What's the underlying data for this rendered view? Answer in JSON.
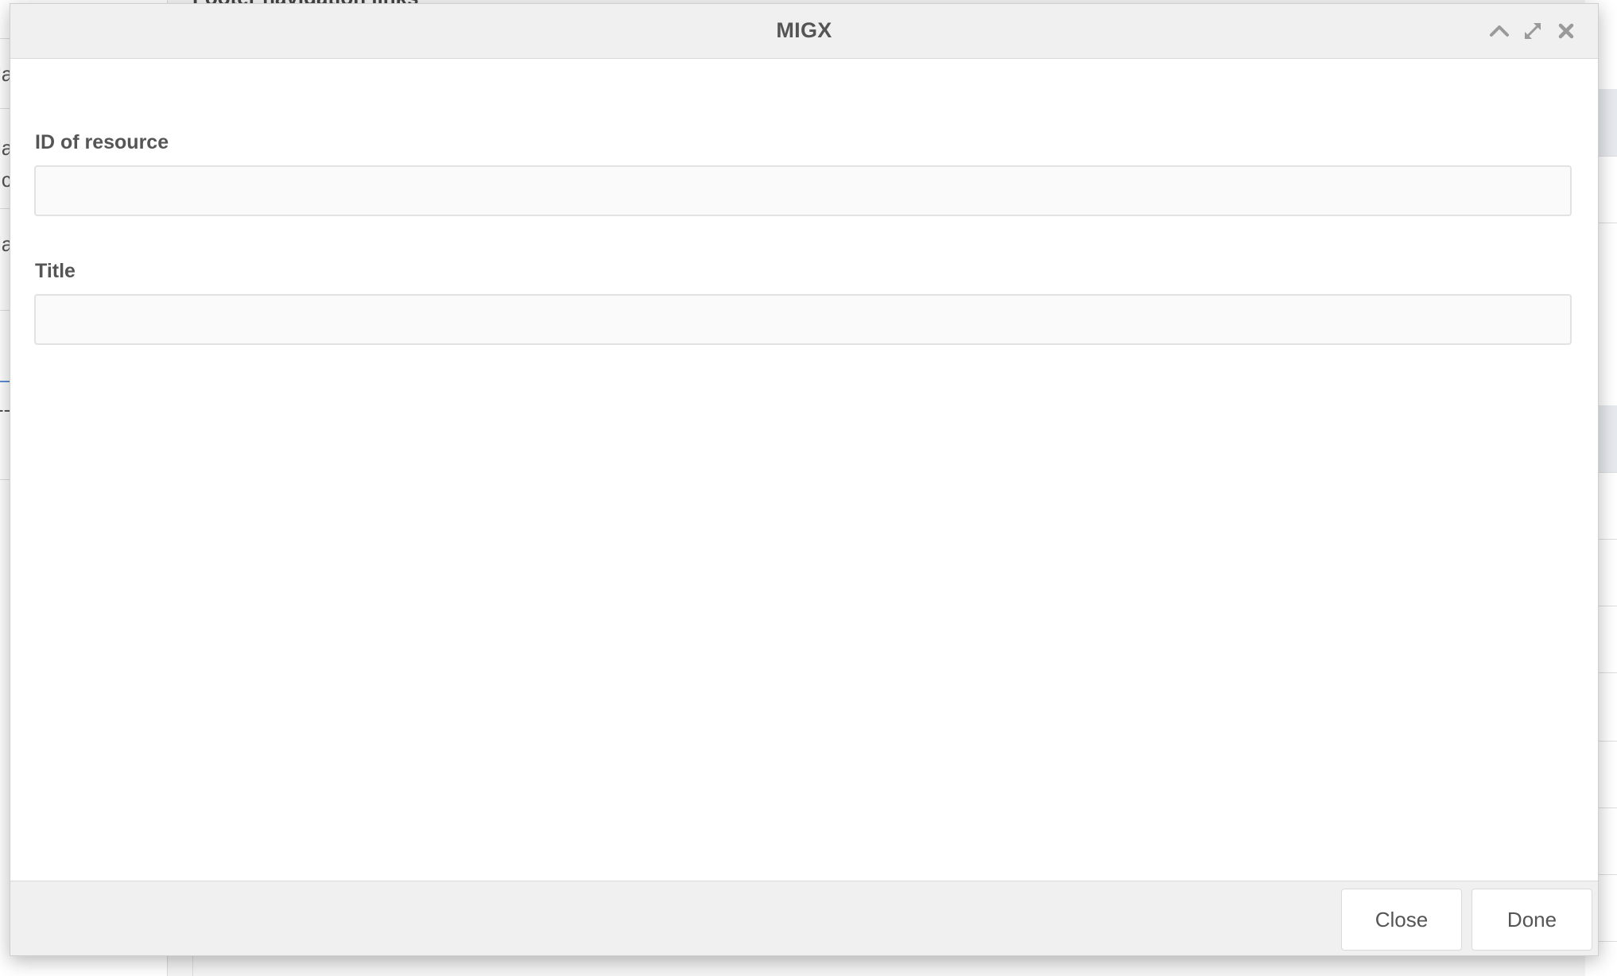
{
  "background": {
    "heading": "Footer navigation links",
    "left_rows": [
      {
        "text": "la"
      },
      {
        "text": "la\nic"
      },
      {
        "text": "la"
      },
      {
        "text": ""
      },
      {
        "text": "--"
      }
    ]
  },
  "modal": {
    "title": "MIGX",
    "tools": {
      "collapse_icon": "chevron-up-icon",
      "maximize_icon": "expand-icon",
      "close_icon": "close-icon"
    },
    "fields": [
      {
        "label": "ID of resource",
        "value": "",
        "placeholder": ""
      },
      {
        "label": "Title",
        "value": "",
        "placeholder": ""
      }
    ],
    "footer": {
      "close_label": "Close",
      "done_label": "Done"
    }
  },
  "colors": {
    "header_bg": "#f0f0f0",
    "text": "#555555",
    "icon": "#9a9a9a"
  }
}
